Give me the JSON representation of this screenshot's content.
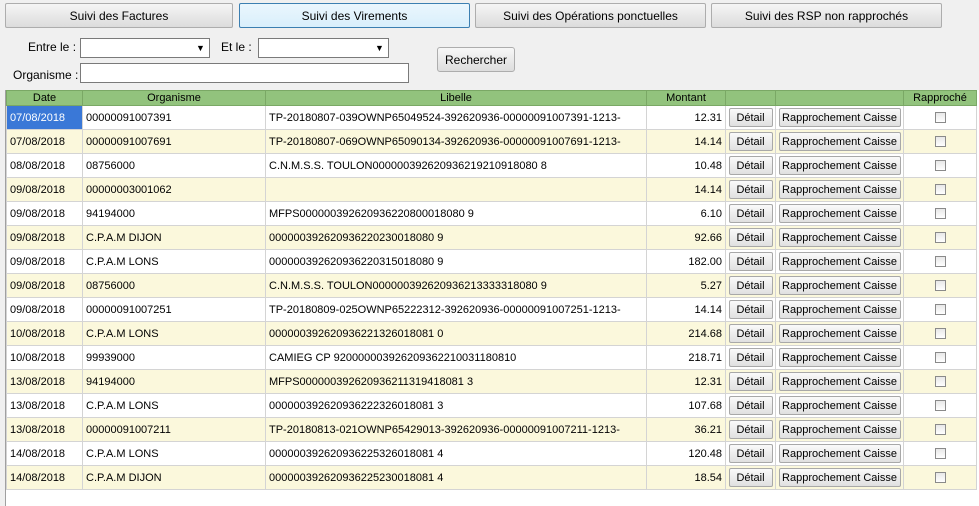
{
  "tabs": [
    {
      "label": "Suivi des Factures"
    },
    {
      "label": "Suivi des Virements"
    },
    {
      "label": "Suivi des Opérations ponctuelles"
    },
    {
      "label": "Suivi des RSP non rapprochés"
    }
  ],
  "filters": {
    "from_label": "Entre le :",
    "from_value": "",
    "to_label": "Et le :",
    "to_value": "",
    "org_label": "Organisme :",
    "org_value": "",
    "search_label": "Rechercher"
  },
  "grid": {
    "columns": {
      "date": "Date",
      "organisme": "Organisme",
      "libelle": "Libelle",
      "montant": "Montant",
      "detail": "",
      "rapprochement": "",
      "rapproche": "Rapproché"
    },
    "detail_label": "Détail",
    "rapprochement_label": "Rapprochement Caisse",
    "rows": [
      {
        "date": "07/08/2018",
        "organisme": "00000091007391",
        "libelle": "TP-20180807-039OWNP65049524-392620936-00000091007391-1213-",
        "montant": "12.31",
        "checked": false
      },
      {
        "date": "07/08/2018",
        "organisme": "00000091007691",
        "libelle": "TP-20180807-069OWNP65090134-392620936-00000091007691-1213-",
        "montant": "14.14",
        "checked": false
      },
      {
        "date": "08/08/2018",
        "organisme": "08756000",
        "libelle": "C.N.M.S.S. TOULON000000392620936219210918080 8",
        "montant": "10.48",
        "checked": false
      },
      {
        "date": "09/08/2018",
        "organisme": "00000003001062",
        "libelle": "",
        "montant": "14.14",
        "checked": false
      },
      {
        "date": "09/08/2018",
        "organisme": "94194000",
        "libelle": "MFPS000000392620936220800018080 9",
        "montant": "6.10",
        "checked": false
      },
      {
        "date": "09/08/2018",
        "organisme": "C.P.A.M DIJON",
        "libelle": "000000392620936220230018080 9",
        "montant": "92.66",
        "checked": false
      },
      {
        "date": "09/08/2018",
        "organisme": "C.P.A.M LONS",
        "libelle": "000000392620936220315018080 9",
        "montant": "182.00",
        "checked": false
      },
      {
        "date": "09/08/2018",
        "organisme": "08756000",
        "libelle": "C.N.M.S.S. TOULON000000392620936213333318080 9",
        "montant": "5.27",
        "checked": false
      },
      {
        "date": "09/08/2018",
        "organisme": "00000091007251",
        "libelle": "TP-20180809-025OWNP65222312-392620936-00000091007251-1213-",
        "montant": "14.14",
        "checked": false
      },
      {
        "date": "10/08/2018",
        "organisme": "C.P.A.M LONS",
        "libelle": "000000392620936221326018081 0",
        "montant": "214.68",
        "checked": false
      },
      {
        "date": "10/08/2018",
        "organisme": "99939000",
        "libelle": "CAMIEG CP 920000003926209362210031180810",
        "montant": "218.71",
        "checked": false
      },
      {
        "date": "13/08/2018",
        "organisme": "94194000",
        "libelle": "MFPS000000392620936211319418081 3",
        "montant": "12.31",
        "checked": false
      },
      {
        "date": "13/08/2018",
        "organisme": "C.P.A.M LONS",
        "libelle": "000000392620936222326018081 3",
        "montant": "107.68",
        "checked": false
      },
      {
        "date": "13/08/2018",
        "organisme": "00000091007211",
        "libelle": "TP-20180813-021OWNP65429013-392620936-00000091007211-1213-",
        "montant": "36.21",
        "checked": false
      },
      {
        "date": "14/08/2018",
        "organisme": "C.P.A.M LONS",
        "libelle": "000000392620936225326018081 4",
        "montant": "120.48",
        "checked": false
      },
      {
        "date": "14/08/2018",
        "organisme": "C.P.A.M DIJON",
        "libelle": "000000392620936225230018081 4",
        "montant": "18.54",
        "checked": false
      }
    ]
  }
}
